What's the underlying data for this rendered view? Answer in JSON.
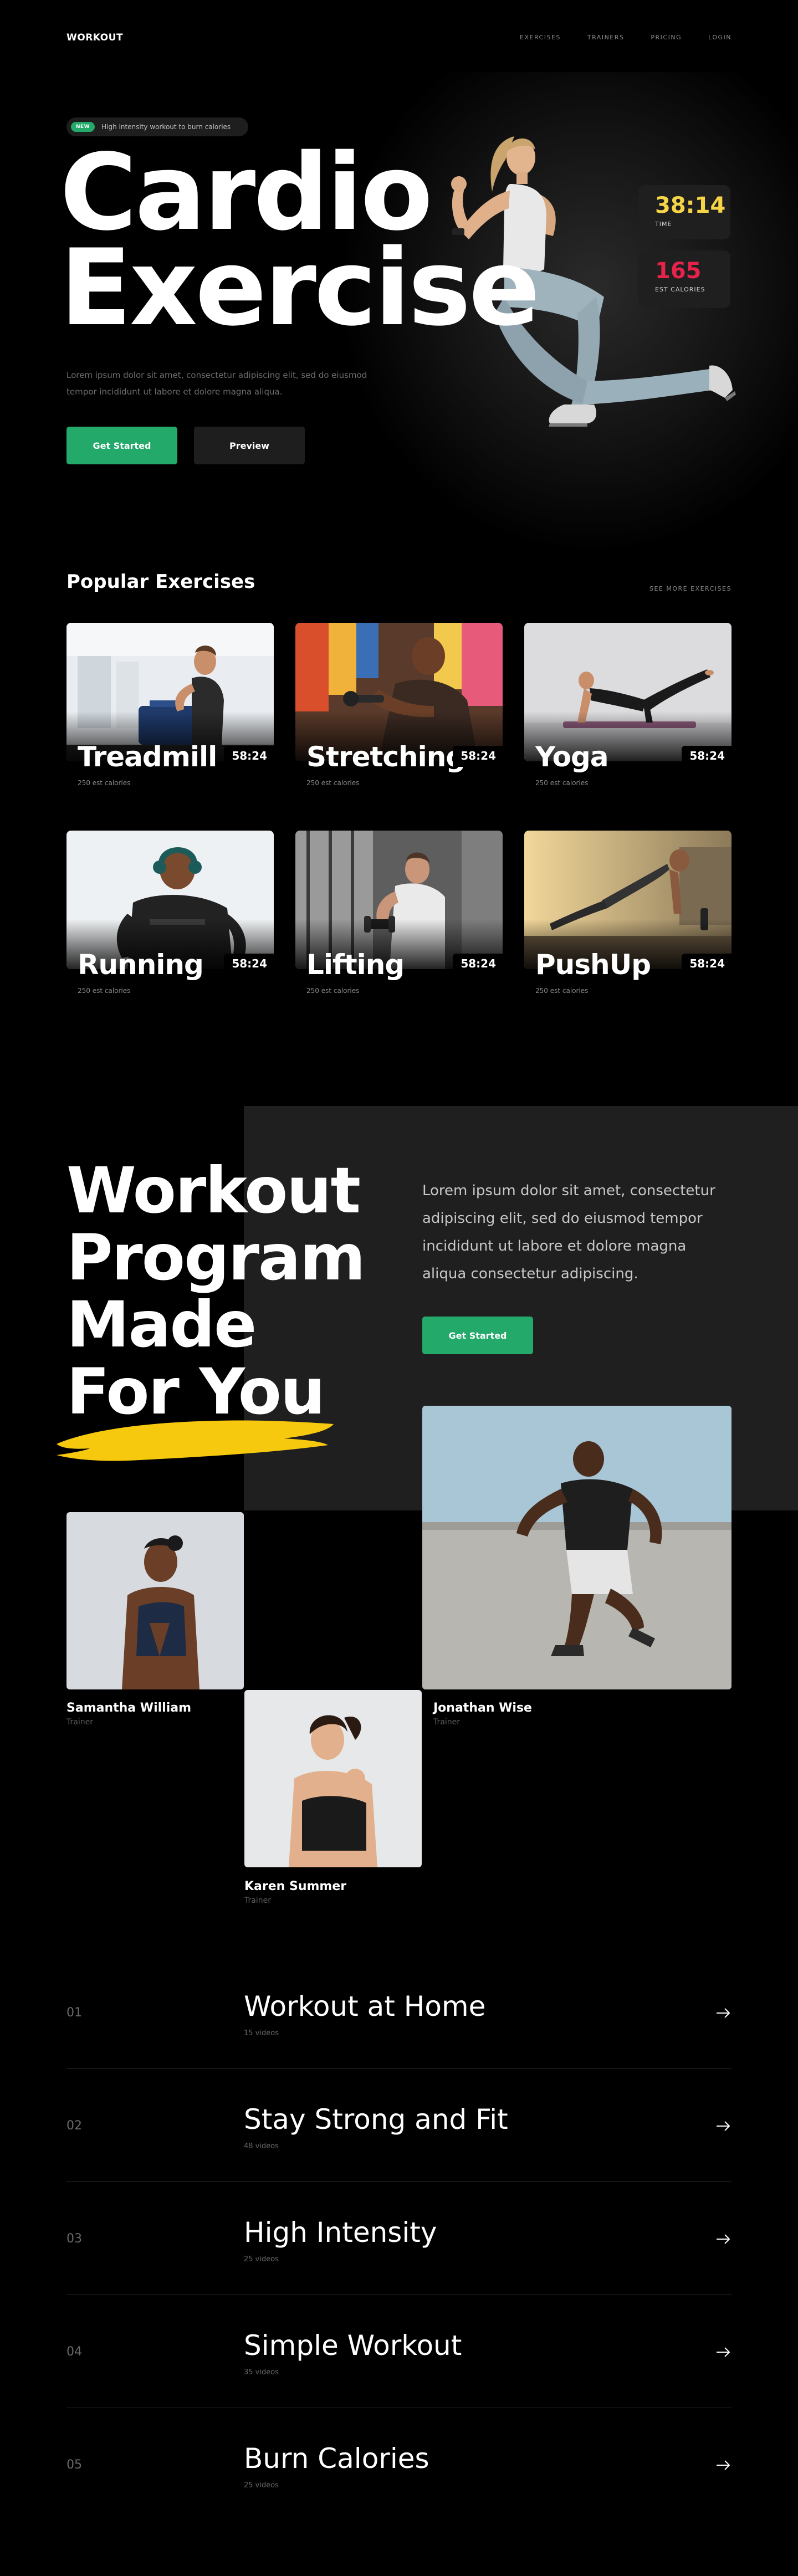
{
  "nav": {
    "logo": "WORKOUT",
    "links": [
      "EXERCISES",
      "TRAINERS",
      "PRICING",
      "LOGIN"
    ]
  },
  "hero": {
    "badge_new": "NEW",
    "badge_text": "High intensity workout to burn calories",
    "title_line1": "Cardio",
    "title_line2": "Exercise",
    "description": "Lorem ipsum dolor sit amet, consectetur adipiscing elit, sed do eiusmod tempor incididunt ut labore et dolore magna aliqua.",
    "primary_button": "Get Started",
    "secondary_button": "Preview",
    "stats": [
      {
        "value": "38:14",
        "label": "TIME",
        "color": "#f5d547"
      },
      {
        "value": "165",
        "label": "EST CALORIES",
        "color": "#e7224b"
      }
    ]
  },
  "popular": {
    "title": "Popular Exercises",
    "see_more": "SEE MORE EXERCISES",
    "cards": [
      {
        "name": "Treadmill",
        "time": "58:24",
        "calories": "250 est calories"
      },
      {
        "name": "Stretching",
        "time": "58:24",
        "calories": "250 est calories"
      },
      {
        "name": "Yoga",
        "time": "58:24",
        "calories": "250 est calories"
      },
      {
        "name": "Running",
        "time": "58:24",
        "calories": "250 est calories"
      },
      {
        "name": "Lifting",
        "time": "58:24",
        "calories": "250 est calories"
      },
      {
        "name": "PushUp",
        "time": "58:24",
        "calories": "250 est calories"
      }
    ]
  },
  "program": {
    "title_lines": [
      "Workout",
      "Program",
      "Made",
      "For You"
    ],
    "description": "Lorem ipsum dolor sit amet, consectetur adipiscing elit, sed do eiusmod tempor incididunt ut labore et dolore magna aliqua consectetur adipiscing.",
    "button": "Get Started",
    "trainers": [
      {
        "name": "Samantha William",
        "role": "Trainer"
      },
      {
        "name": "Karen Summer",
        "role": "Trainer"
      },
      {
        "name": "Jonathan Wise",
        "role": "Trainer"
      }
    ]
  },
  "workouts": [
    {
      "num": "01",
      "title": "Workout at Home",
      "videos": "15 videos"
    },
    {
      "num": "02",
      "title": "Stay Strong and Fit",
      "videos": "48 videos"
    },
    {
      "num": "03",
      "title": "High Intensity",
      "videos": "25 videos"
    },
    {
      "num": "04",
      "title": "Simple Workout",
      "videos": "35 videos"
    },
    {
      "num": "05",
      "title": "Burn Calories",
      "videos": "25 videos"
    }
  ],
  "colors": {
    "accent_green": "#23a96a",
    "accent_yellow": "#f5d547",
    "accent_red": "#e7224b"
  }
}
